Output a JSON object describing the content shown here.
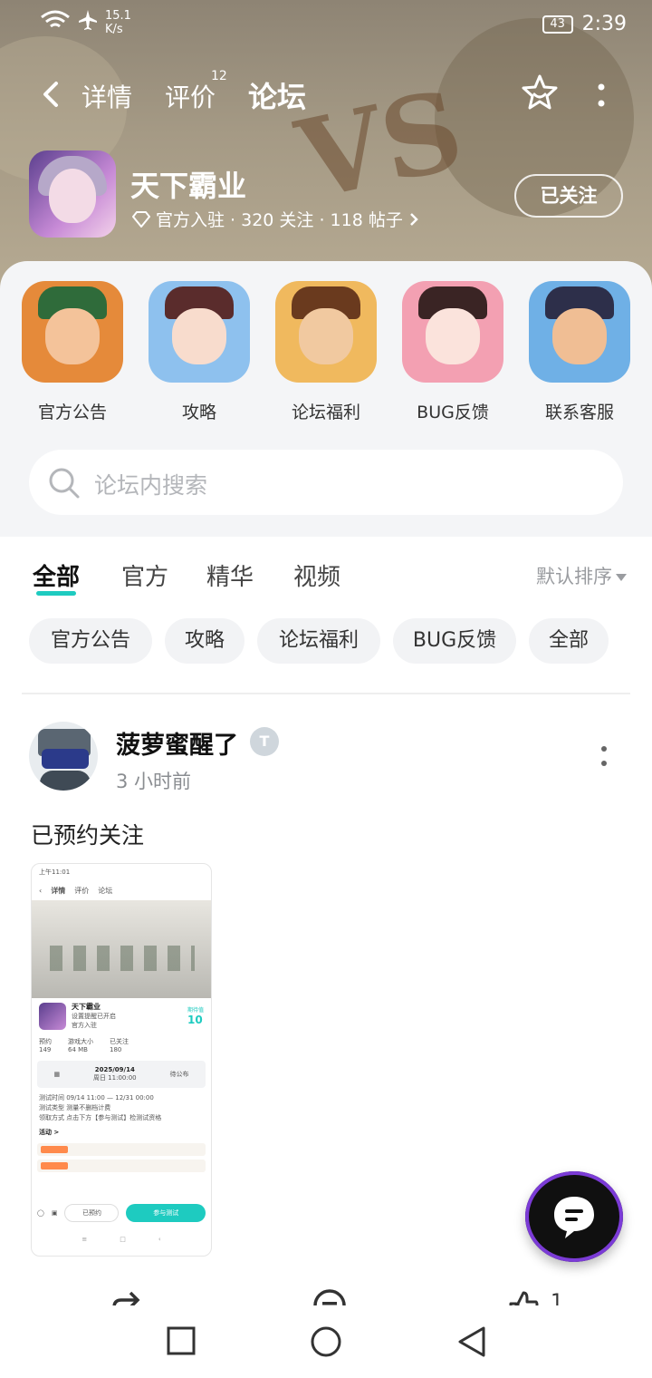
{
  "status_bar": {
    "network_speed": "15.1\nK/s",
    "battery": "43",
    "time": "2:39"
  },
  "nav": {
    "tabs": [
      {
        "label": "详情"
      },
      {
        "label": "评价"
      },
      {
        "label": "论坛"
      }
    ],
    "review_badge": "12",
    "active_tab": "论坛"
  },
  "game": {
    "title": "天下霸业",
    "meta": "官方入驻 · 320 关注 · 118 帖子",
    "follow_label": "已关注"
  },
  "shortcuts": [
    {
      "label": "官方公告",
      "color": "#f0b46a"
    },
    {
      "label": "攻略",
      "color": "#9ec7f0"
    },
    {
      "label": "论坛福利",
      "color": "#f1c27a"
    },
    {
      "label": "BUG反馈",
      "color": "#f5a7b8"
    },
    {
      "label": "联系客服",
      "color": "#7fb7e8"
    }
  ],
  "search": {
    "placeholder": "论坛内搜索"
  },
  "filter_tabs": [
    {
      "label": "全部"
    },
    {
      "label": "官方"
    },
    {
      "label": "精华"
    },
    {
      "label": "视频"
    }
  ],
  "sort_label": "默认排序",
  "chips": [
    {
      "label": "官方公告"
    },
    {
      "label": "攻略"
    },
    {
      "label": "论坛福利"
    },
    {
      "label": "BUG反馈"
    },
    {
      "label": "全部"
    }
  ],
  "post": {
    "username": "菠萝蜜醒了",
    "level_badge": "T",
    "time": "3 小时前",
    "text": "已预约关注",
    "image": {
      "status_time": "上午11:01",
      "nav": [
        "详情",
        "评价",
        "论坛"
      ],
      "game_title": "天下霸业",
      "game_sub": "设置提醒已开启",
      "official": "官方入驻",
      "score_label": "期待值",
      "score": "10",
      "stats": [
        {
          "label": "预约",
          "value": "149"
        },
        {
          "label": "游戏大小",
          "value": "64 MB"
        },
        {
          "label": "已关注",
          "value": "180"
        }
      ],
      "test_date": "2025/09/14",
      "test_time": "周日 11:00:00",
      "test_status": "待公布",
      "test_info_1": "测试时间  09/14 11:00 — 12/31 00:00",
      "test_info_2": "测试类型  测量不删档计费",
      "test_info_3": "领取方式  点击下方【参与测试】检测试资格",
      "activity_label": "活动 >",
      "btn_reserved": "已预约",
      "btn_join": "参与测试"
    }
  },
  "actions": {
    "like_count": "1"
  },
  "colors": {
    "accent": "#1ecbc0",
    "banner": "#a59a85"
  }
}
